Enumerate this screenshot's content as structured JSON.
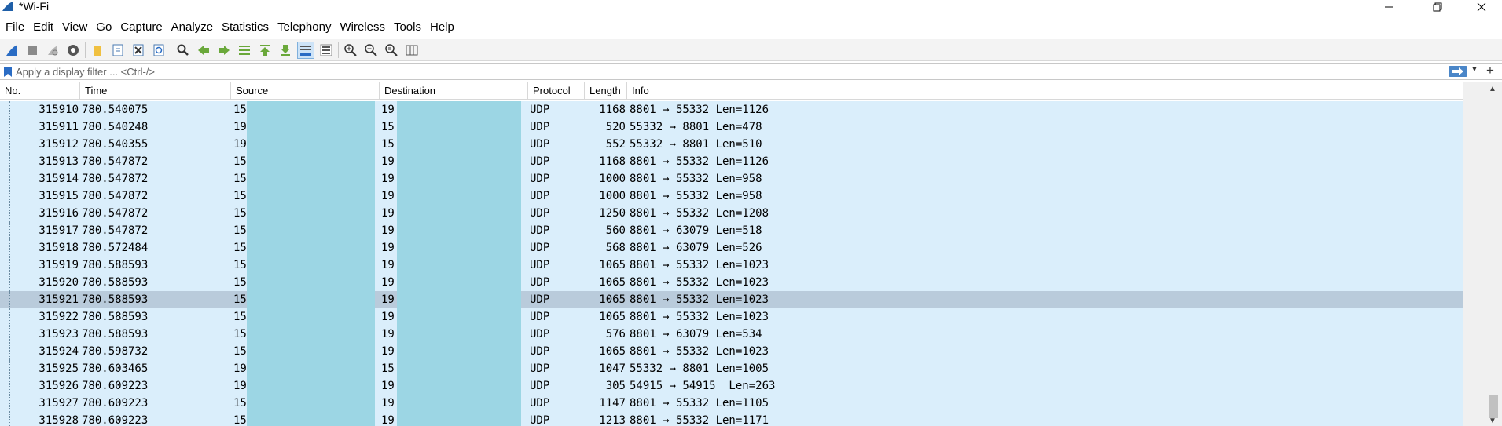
{
  "window": {
    "title": "*Wi-Fi",
    "minimize_glyph": "—",
    "maximize_glyph": "❐",
    "close_glyph": "✕"
  },
  "menu": [
    "File",
    "Edit",
    "View",
    "Go",
    "Capture",
    "Analyze",
    "Statistics",
    "Telephony",
    "Wireless",
    "Tools",
    "Help"
  ],
  "toolbar": {
    "icons": [
      "shark-fin-start-icon",
      "stop-capture-icon",
      "restart-capture-icon",
      "capture-options-icon",
      "open-file-icon",
      "save-file-icon",
      "close-file-icon",
      "reload-file-icon",
      "find-packet-icon",
      "go-back-icon",
      "go-forward-icon",
      "go-to-packet-icon",
      "go-first-packet-icon",
      "go-last-packet-icon",
      "autoscroll-icon",
      "colorize-icon",
      "zoom-in-icon",
      "zoom-out-icon",
      "normal-size-icon",
      "resize-columns-icon"
    ]
  },
  "filter": {
    "placeholder": "Apply a display filter ... <Ctrl-/>",
    "value": ""
  },
  "columns": {
    "no": "No.",
    "time": "Time",
    "source": "Source",
    "destination": "Destination",
    "protocol": "Protocol",
    "length": "Length",
    "info": "Info"
  },
  "selected_packet": "315921",
  "packets": [
    {
      "no": "315910",
      "time": "780.540075",
      "src": "15",
      "dst": "19",
      "proto": "UDP",
      "len": "1168",
      "info": "8801 → 55332 Len=1126"
    },
    {
      "no": "315911",
      "time": "780.540248",
      "src": "19",
      "dst": "15",
      "proto": "UDP",
      "len": "520",
      "info": "55332 → 8801 Len=478"
    },
    {
      "no": "315912",
      "time": "780.540355",
      "src": "19",
      "dst": "15",
      "proto": "UDP",
      "len": "552",
      "info": "55332 → 8801 Len=510"
    },
    {
      "no": "315913",
      "time": "780.547872",
      "src": "15",
      "dst": "19",
      "proto": "UDP",
      "len": "1168",
      "info": "8801 → 55332 Len=1126"
    },
    {
      "no": "315914",
      "time": "780.547872",
      "src": "15",
      "dst": "19",
      "proto": "UDP",
      "len": "1000",
      "info": "8801 → 55332 Len=958"
    },
    {
      "no": "315915",
      "time": "780.547872",
      "src": "15",
      "dst": "19",
      "proto": "UDP",
      "len": "1000",
      "info": "8801 → 55332 Len=958"
    },
    {
      "no": "315916",
      "time": "780.547872",
      "src": "15",
      "dst": "19",
      "proto": "UDP",
      "len": "1250",
      "info": "8801 → 55332 Len=1208"
    },
    {
      "no": "315917",
      "time": "780.547872",
      "src": "15",
      "dst": "19",
      "proto": "UDP",
      "len": "560",
      "info": "8801 → 63079 Len=518"
    },
    {
      "no": "315918",
      "time": "780.572484",
      "src": "15",
      "dst": "19",
      "proto": "UDP",
      "len": "568",
      "info": "8801 → 63079 Len=526"
    },
    {
      "no": "315919",
      "time": "780.588593",
      "src": "15",
      "dst": "19",
      "proto": "UDP",
      "len": "1065",
      "info": "8801 → 55332 Len=1023"
    },
    {
      "no": "315920",
      "time": "780.588593",
      "src": "15",
      "dst": "19",
      "proto": "UDP",
      "len": "1065",
      "info": "8801 → 55332 Len=1023"
    },
    {
      "no": "315921",
      "time": "780.588593",
      "src": "15",
      "dst": "19",
      "proto": "UDP",
      "len": "1065",
      "info": "8801 → 55332 Len=1023"
    },
    {
      "no": "315922",
      "time": "780.588593",
      "src": "15",
      "dst": "19",
      "proto": "UDP",
      "len": "1065",
      "info": "8801 → 55332 Len=1023"
    },
    {
      "no": "315923",
      "time": "780.588593",
      "src": "15",
      "dst": "19",
      "proto": "UDP",
      "len": "576",
      "info": "8801 → 63079 Len=534"
    },
    {
      "no": "315924",
      "time": "780.598732",
      "src": "15",
      "dst": "19",
      "proto": "UDP",
      "len": "1065",
      "info": "8801 → 55332 Len=1023"
    },
    {
      "no": "315925",
      "time": "780.603465",
      "src": "19",
      "dst": "15",
      "proto": "UDP",
      "len": "1047",
      "info": "55332 → 8801 Len=1005"
    },
    {
      "no": "315926",
      "time": "780.609223",
      "src": "19",
      "dst": "19",
      "proto": "UDP",
      "len": "305",
      "info": "54915 → 54915  Len=263"
    },
    {
      "no": "315927",
      "time": "780.609223",
      "src": "15",
      "dst": "19",
      "proto": "UDP",
      "len": "1147",
      "info": "8801 → 55332 Len=1105"
    },
    {
      "no": "315928",
      "time": "780.609223",
      "src": "15",
      "dst": "19",
      "proto": "UDP",
      "len": "1213",
      "info": "8801 → 55332 Len=1171"
    }
  ],
  "colors": {
    "row_bg": "#daeefb",
    "row_selected_bg": "#b9cbdb",
    "redaction": "#9cd6e4",
    "filter_apply": "#4a86c8"
  }
}
